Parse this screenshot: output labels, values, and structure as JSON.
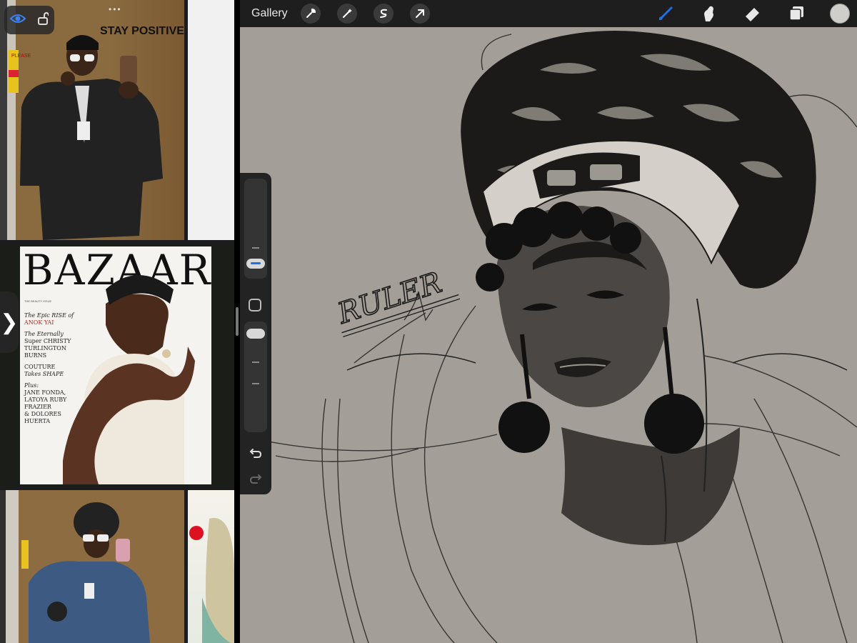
{
  "topbar": {
    "gallery_label": "Gallery",
    "tools": [
      "wrench-icon",
      "magic-wand-icon",
      "selection-icon",
      "transform-arrow-icon"
    ],
    "right_tools": [
      "brush-icon",
      "smudge-icon",
      "eraser-icon",
      "layers-icon"
    ],
    "active_tool": "brush-icon",
    "accent_color": "#1e6fe8",
    "current_color": "#d0ceca"
  },
  "reference": {
    "magazine": {
      "title": "BAZAAR",
      "issue": "THE BEAUTY ISSUE",
      "lines": [
        {
          "text": "The Epic RISE of",
          "style": "italic"
        },
        {
          "text": "ANOK YAI",
          "style": "red"
        },
        {
          "text": "The Eternally",
          "style": "italic"
        },
        {
          "text": "Super CHRISTY",
          "style": "normal"
        },
        {
          "text": "TURLINGTON",
          "style": "normal"
        },
        {
          "text": "BURNS",
          "style": "normal"
        },
        {
          "text": "COUTURE",
          "style": "normal"
        },
        {
          "text": "Takes SHAPE",
          "style": "normal"
        },
        {
          "text": "Plus:",
          "style": "italic"
        },
        {
          "text": "JANE FONDA,",
          "style": "normal"
        },
        {
          "text": "LATOYA RUBY",
          "style": "normal"
        },
        {
          "text": "FRAZIER",
          "style": "normal"
        },
        {
          "text": "& DOLORES",
          "style": "normal"
        },
        {
          "text": "HUERTA",
          "style": "normal"
        }
      ]
    },
    "sign_text": "STAY POSITIVE",
    "poster_text": "PLEASE"
  },
  "canvas": {
    "background_color": "#a39f98",
    "sketch_lettering": "RULER"
  }
}
